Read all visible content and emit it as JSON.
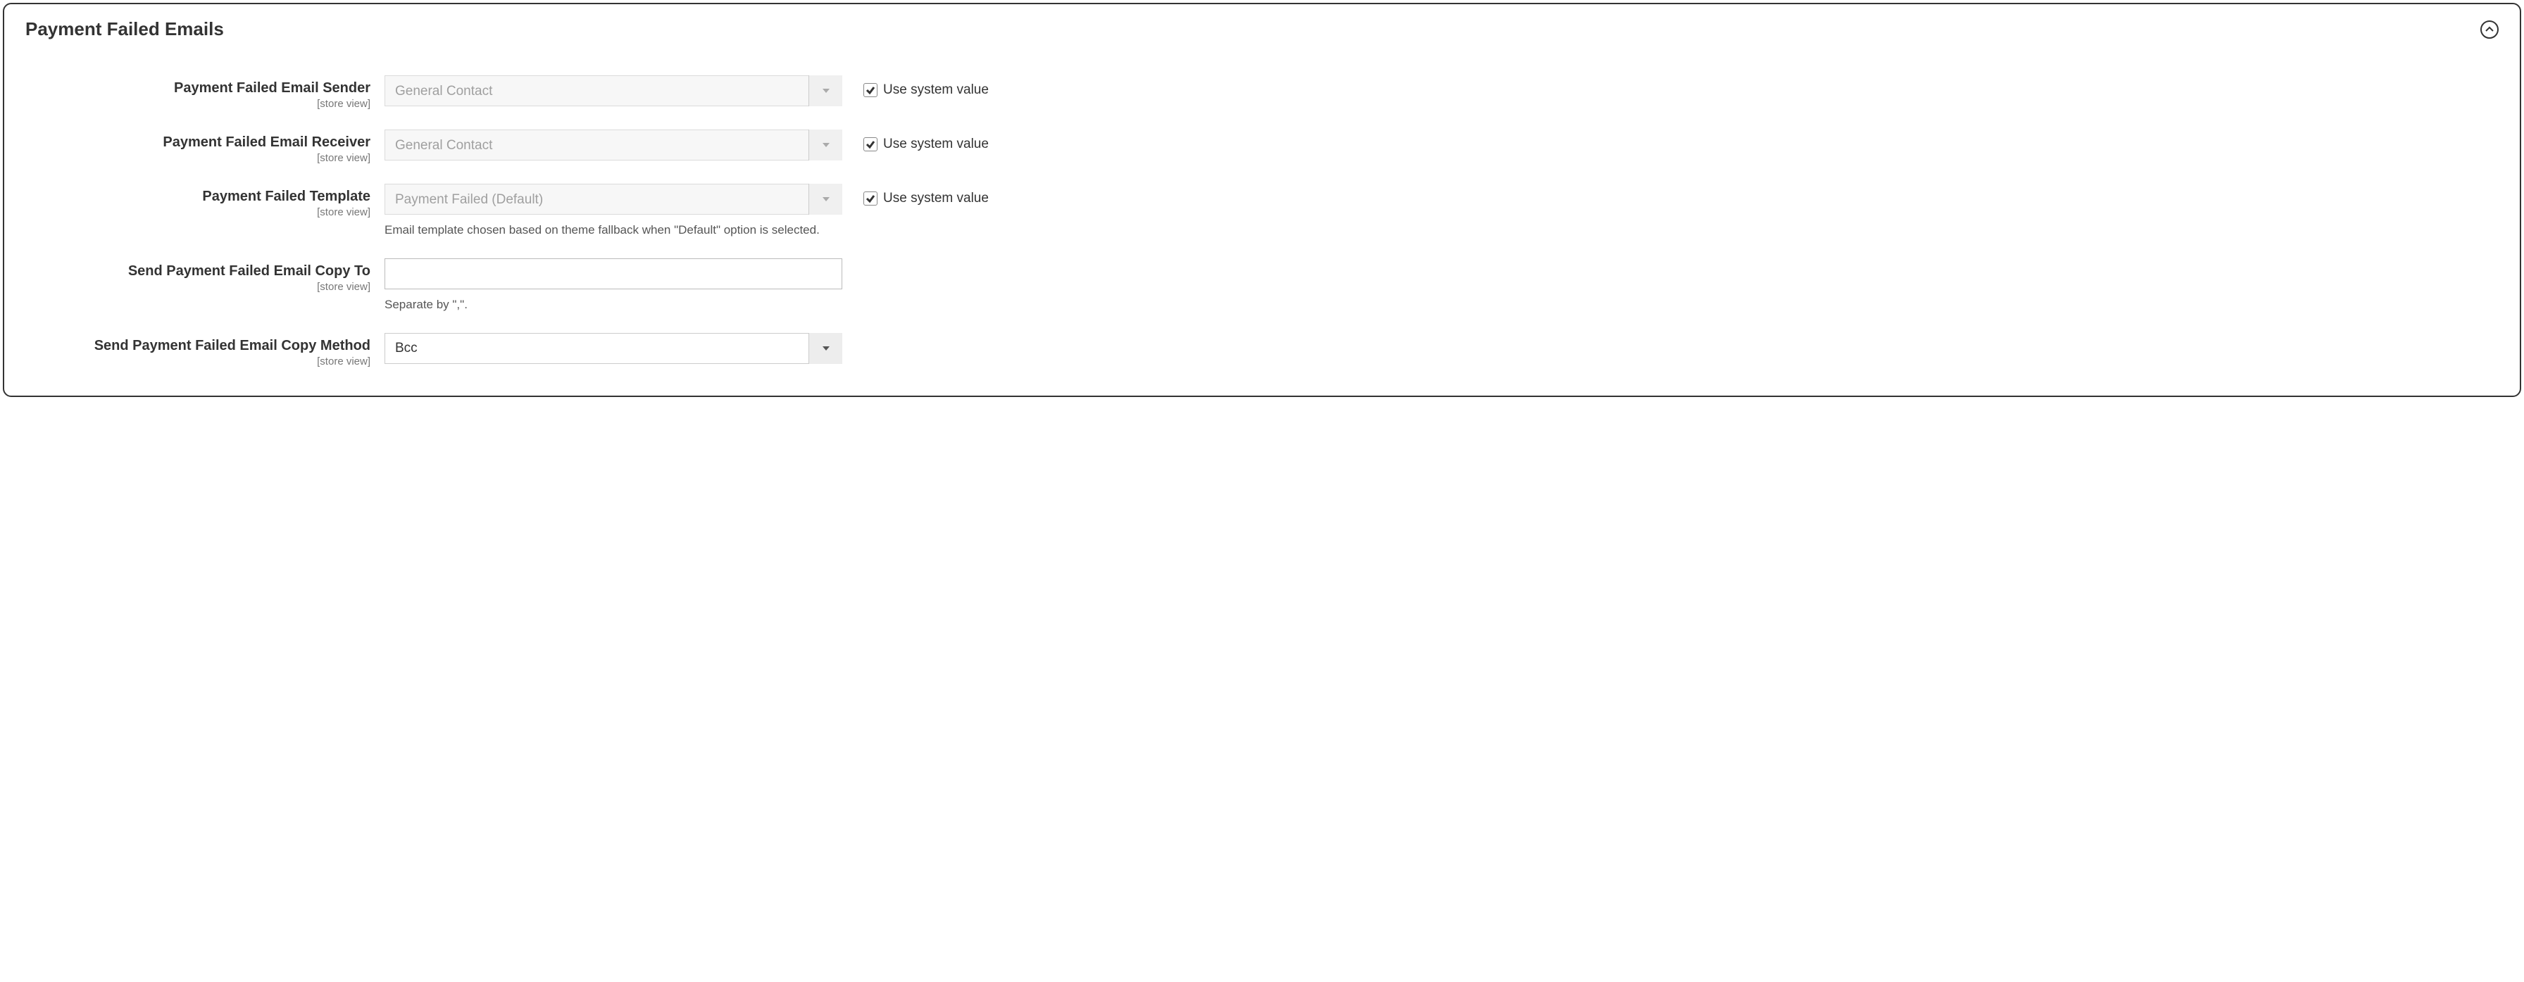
{
  "panel": {
    "title": "Payment Failed Emails"
  },
  "fields": {
    "sender": {
      "label": "Payment Failed Email Sender",
      "scope": "[store view]",
      "value": "General Contact",
      "use_system": "Use system value"
    },
    "receiver": {
      "label": "Payment Failed Email Receiver",
      "scope": "[store view]",
      "value": "General Contact",
      "use_system": "Use system value"
    },
    "template": {
      "label": "Payment Failed Template",
      "scope": "[store view]",
      "value": "Payment Failed (Default)",
      "help": "Email template chosen based on theme fallback when \"Default\" option is selected.",
      "use_system": "Use system value"
    },
    "copy_to": {
      "label": "Send Payment Failed Email Copy To",
      "scope": "[store view]",
      "value": "",
      "help": "Separate by \",\"."
    },
    "copy_method": {
      "label": "Send Payment Failed Email Copy Method",
      "scope": "[store view]",
      "value": "Bcc"
    }
  }
}
